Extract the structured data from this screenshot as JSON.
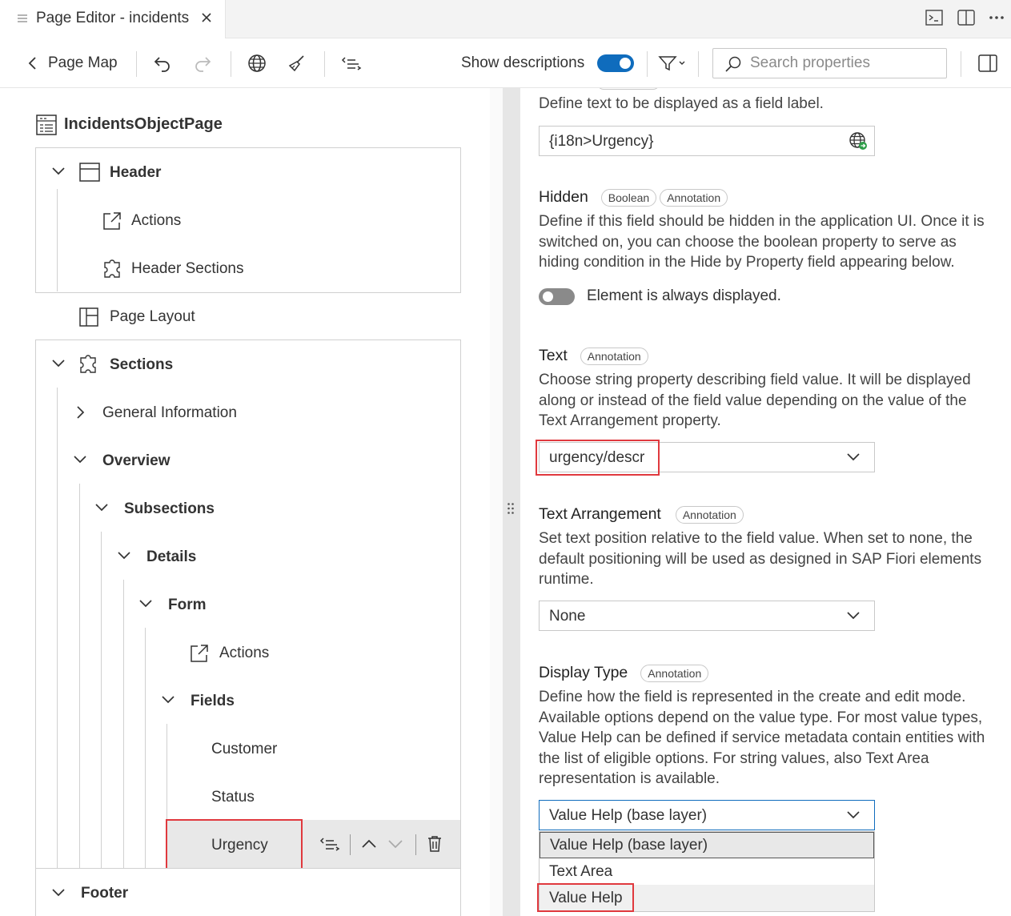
{
  "tab": {
    "title": "Page Editor - incidents"
  },
  "toolbar": {
    "back_label": "Page Map",
    "show_descriptions_label": "Show descriptions",
    "show_descriptions_on": true,
    "search_placeholder": "Search properties"
  },
  "tree": {
    "page_title": "IncidentsObjectPage",
    "header": "Header",
    "header_actions": "Actions",
    "header_sections": "Header Sections",
    "page_layout": "Page Layout",
    "sections": "Sections",
    "general_information": "General Information",
    "overview": "Overview",
    "subsections": "Subsections",
    "details": "Details",
    "form": "Form",
    "form_actions": "Actions",
    "fields": "Fields",
    "field_items": [
      "Customer",
      "Status",
      "Urgency"
    ],
    "footer": "Footer"
  },
  "properties": {
    "label_desc": "Define text to be displayed as a field label.",
    "label_value": "{i18n>Urgency}",
    "hidden": {
      "title": "Hidden",
      "badges": [
        "Boolean",
        "Annotation"
      ],
      "desc": "Define if this field should be hidden in the application UI. Once it is switched on, you can choose the boolean property to serve as hiding condition in the Hide by Property field appearing below.",
      "toggle_text": "Element is always displayed.",
      "on": false
    },
    "text": {
      "title": "Text",
      "badges": [
        "Annotation"
      ],
      "desc": "Choose string property describing field value. It will be displayed along or instead of the field value depending on the value of the Text Arrangement property.",
      "value": "urgency/descr"
    },
    "text_arrangement": {
      "title": "Text Arrangement",
      "badges": [
        "Annotation"
      ],
      "desc": "Set text position relative to the field value. When set to none, the default positioning will be used as designed in SAP Fiori elements runtime.",
      "value": "None"
    },
    "display_type": {
      "title": "Display Type",
      "badges": [
        "Annotation"
      ],
      "desc": "Define how the field is represented in the create and edit mode. Available options depend on the value type. For most value types, Value Help can be defined if service metadata contain entities with the list of eligible options. For string values, also Text Area representation is available.",
      "value": "Value Help (base layer)",
      "options": [
        "Value Help (base layer)",
        "Text Area",
        "Value Help"
      ]
    }
  },
  "colors": {
    "accent": "#0f6cbd",
    "highlight": "#e0393e"
  }
}
